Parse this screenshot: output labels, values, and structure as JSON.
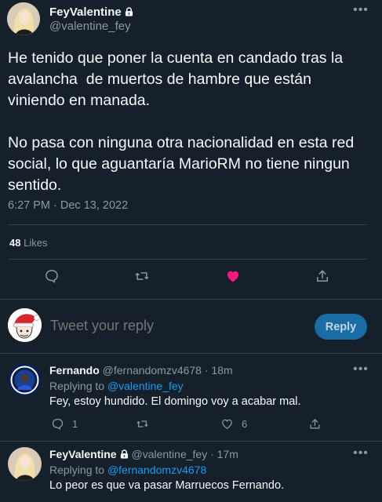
{
  "tweet": {
    "author_name": "FeyValentine",
    "author_handle": "@valentine_fey",
    "paragraph1": "He tenido que poner la cuenta en candado tras la avalancha  de muertos de hambre que están viniendo en manada.",
    "paragraph2": "No pasa con ninguna otra nacionalidad en esta red social, lo que aguantaría MarioRM no tiene ningun sentido.",
    "timestamp": "6:27 PM · Dec 13, 2022",
    "likes_count": "48",
    "likes_label": "Likes",
    "liked": true,
    "colors": {
      "like": "#f91880",
      "accent": "#1d9bf0",
      "background": "#15202b"
    }
  },
  "composer": {
    "placeholder": "Tweet your reply",
    "button_label": "Reply"
  },
  "replies": [
    {
      "name": "Fernando",
      "handle": "@fernandomzv4678",
      "time": "· 18m",
      "replying_label": "Replying to",
      "replying_to": "@valentine_fey",
      "text": "Fey, estoy hundido. El domingo voy a acabar mal.",
      "reply_count": "1",
      "like_count": "6"
    },
    {
      "name": "FeyValentine",
      "handle": "@valentine_fey",
      "time": "· 17m",
      "replying_label": "Replying to",
      "replying_to": "@fernandomzv4678",
      "text": "Lo peor es que va pasar Marruecos Fernando."
    }
  ],
  "icons": {
    "more": "more-horizontal-icon",
    "lock": "lock-icon",
    "reply": "reply-icon",
    "retweet": "retweet-icon",
    "like": "heart-icon",
    "share": "share-icon"
  }
}
